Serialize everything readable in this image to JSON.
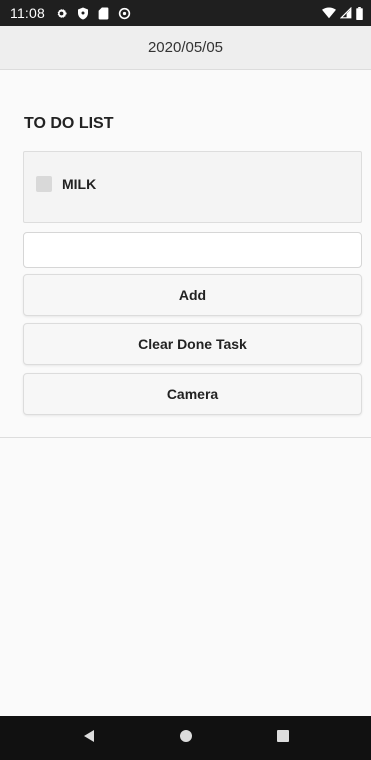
{
  "status_bar": {
    "time": "11:08",
    "left_icons": [
      "gear-icon",
      "shield-icon",
      "sim-card-icon",
      "data-saver-icon"
    ],
    "right_icons": [
      "wifi-icon",
      "cell-signal-icon",
      "battery-icon"
    ]
  },
  "header": {
    "date": "2020/05/05"
  },
  "todo": {
    "title": "TO DO LIST",
    "items": [
      {
        "label": "MILK",
        "done": false
      }
    ]
  },
  "task_input": {
    "value": "",
    "placeholder": ""
  },
  "buttons": {
    "add_label": "Add",
    "clear_label": "Clear Done Task",
    "camera_label": "Camera"
  },
  "nav_bar": {
    "icons": [
      "back-icon",
      "home-icon",
      "recents-icon"
    ]
  },
  "colors": {
    "status_bar_bg": "#1f1f1f",
    "header_bg": "#eeeeee",
    "nav_bar_bg": "#111111",
    "button_bg": "#f7f7f7"
  }
}
